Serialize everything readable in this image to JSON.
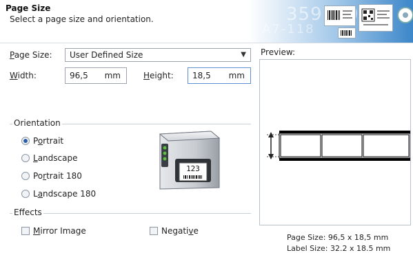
{
  "header": {
    "title": "Page Size",
    "subtitle": "Select a page size and orientation.",
    "banner_text_1": "35976001",
    "banner_text_2": "A7-118"
  },
  "page_size": {
    "label": "Page Size:",
    "value": "User Defined Size"
  },
  "width": {
    "label": "Width:",
    "value": "96,5",
    "unit": "mm"
  },
  "height": {
    "label": "Height:",
    "value": "18,5",
    "unit": "mm"
  },
  "orientation": {
    "title": "Orientation",
    "options": [
      {
        "label": "Portrait",
        "selected": true
      },
      {
        "label": "Landscape",
        "selected": false
      },
      {
        "label": "Portrait 180",
        "selected": false
      },
      {
        "label": "Landscape 180",
        "selected": false
      }
    ]
  },
  "printer_illustration": {
    "label_number": "123"
  },
  "effects": {
    "title": "Effects",
    "mirror_image": {
      "label": "Mirror Image",
      "checked": false
    },
    "negative": {
      "label": "Negative",
      "checked": false
    }
  },
  "preview": {
    "title": "Preview:",
    "page_size_text": "Page Size:  96,5 x 18,5 mm",
    "label_size_text": "Label Size:  32.2 x 18.5 mm"
  },
  "colors": {
    "accent": "#2b5ea7",
    "banner": "#3c86c9",
    "led": "#5cc23a"
  }
}
